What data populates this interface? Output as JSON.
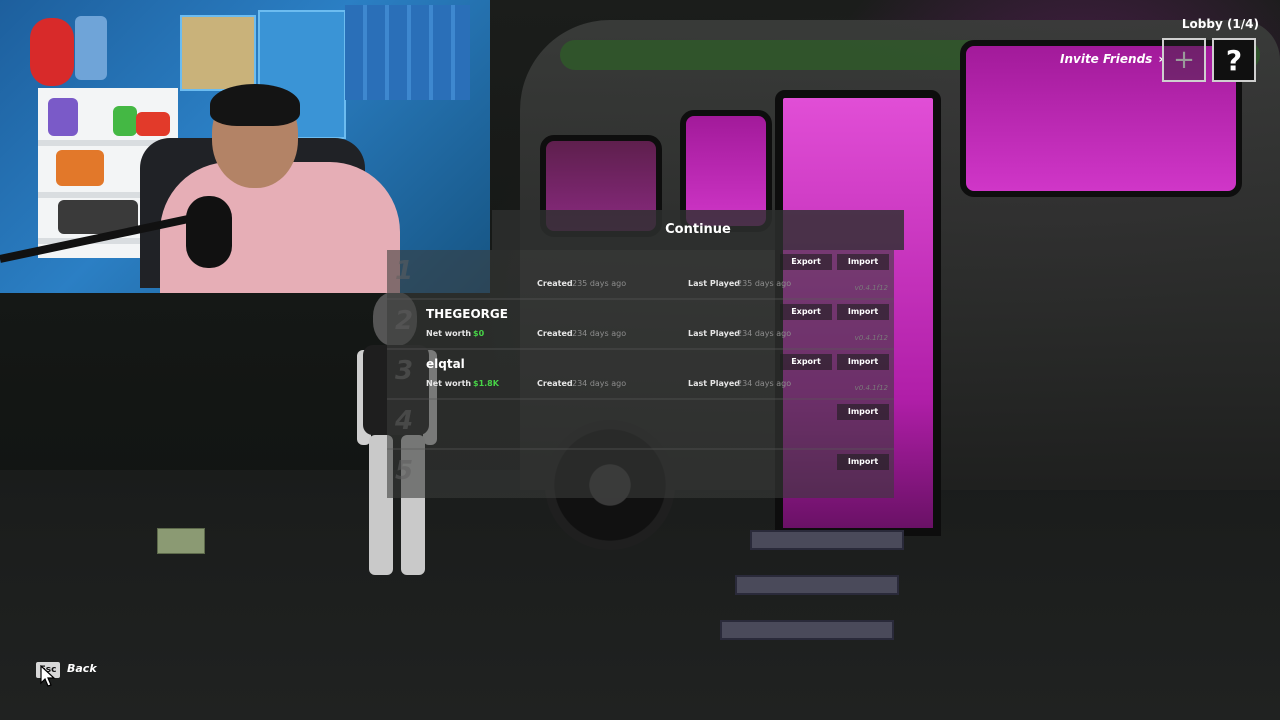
{
  "header": {
    "lobby_label": "Lobby (1/4)",
    "invite_label": "Invite Friends",
    "invite_chevron": "›",
    "add_icon_glyph": "+",
    "help_icon_glyph": "?"
  },
  "menu": {
    "title": "Continue",
    "slots": [
      {
        "number": "1",
        "name": "",
        "net_worth_label": "",
        "net_worth": "",
        "created_label": "Created",
        "created": "235 days ago",
        "last_played_label": "Last Played",
        "last_played": "235 days ago",
        "export_label": "Export",
        "import_label": "Import",
        "version": "v0.4.1f12"
      },
      {
        "number": "2",
        "name": "THEGEORGE",
        "net_worth_label": "Net worth",
        "net_worth": "$0",
        "created_label": "Created",
        "created": "234 days ago",
        "last_played_label": "Last Played",
        "last_played": "234 days ago",
        "export_label": "Export",
        "import_label": "Import",
        "version": "v0.4.1f12"
      },
      {
        "number": "3",
        "name": "elqtal",
        "net_worth_label": "Net worth",
        "net_worth": "$1.8K",
        "created_label": "Created",
        "created": "234 days ago",
        "last_played_label": "Last Played",
        "last_played": "234 days ago",
        "export_label": "Export",
        "import_label": "Import",
        "version": "v0.4.1f12"
      },
      {
        "number": "4",
        "import_label": "Import"
      },
      {
        "number": "5",
        "import_label": "Import"
      }
    ]
  },
  "footer": {
    "esc_key": "Esc",
    "back_label": "Back"
  },
  "colors": {
    "money_green": "#47d447",
    "rv_magenta": "#d036c8",
    "panel_bg": "#2d2f2e"
  }
}
